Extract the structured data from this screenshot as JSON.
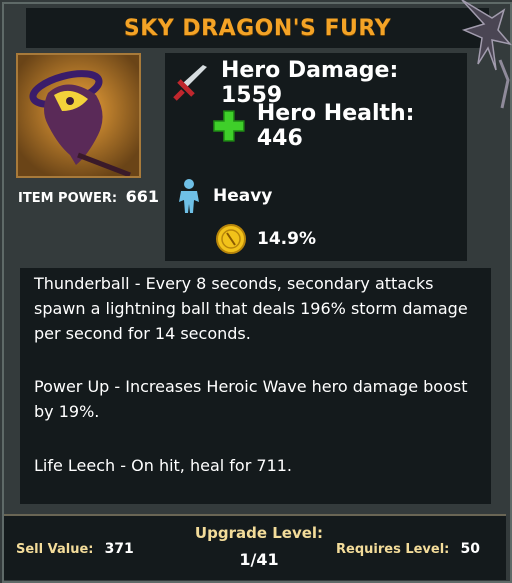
{
  "item": {
    "name": "SKY DRAGON'S FURY",
    "power_label": "ITEM POWER:",
    "power_value": "661"
  },
  "stats": {
    "damage": "Hero Damage: 1559",
    "health": "Hero Health: 446",
    "weight": "Heavy",
    "crit": "14.9%"
  },
  "icons": {
    "damage": "sword-icon",
    "health": "plus-icon",
    "weight": "figure-icon",
    "crit": "gold-coin-icon",
    "item": "dragon-staff-icon"
  },
  "description": {
    "p1": "Thunderball - Every 8 seconds, secondary attacks spawn a lightning ball that deals 196% storm damage per second for 14 seconds.",
    "p2": "Power Up - Increases Heroic Wave hero damage boost by 19%.",
    "p3": "Life Leech - On hit, heal for 711."
  },
  "footer": {
    "sell_label": "Sell Value:",
    "sell_value": "371",
    "upgrade_label": "Upgrade Level:",
    "upgrade_value": "1/41",
    "requires_label": "Requires Level:",
    "requires_value": "50"
  },
  "colors": {
    "title": "#f4a326",
    "panel": "#141a1c",
    "background": "#343b3c",
    "health_green": "#3fcf2a",
    "footer_label": "#f3dc9a"
  }
}
